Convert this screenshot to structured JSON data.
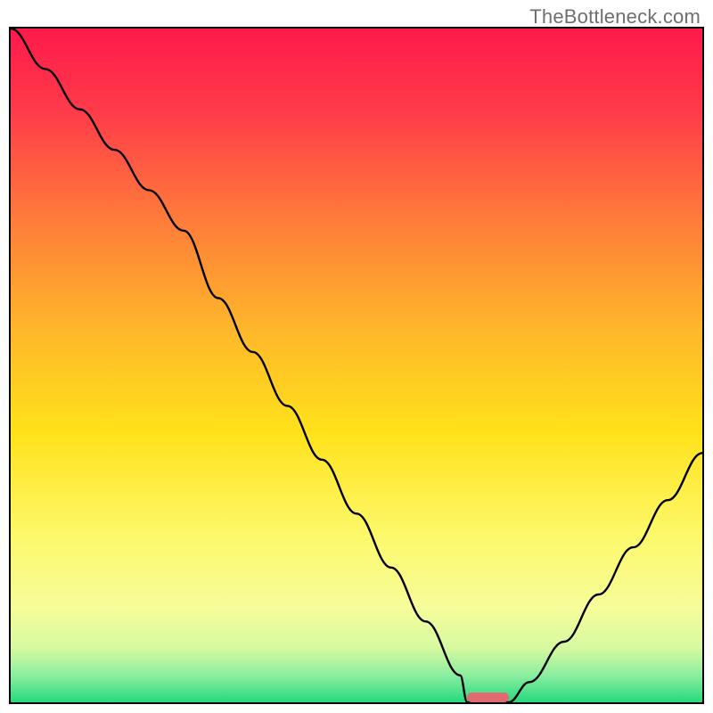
{
  "watermark": "TheBottleneck.com",
  "chart_data": {
    "type": "line",
    "title": "",
    "xlabel": "",
    "ylabel": "",
    "xlim": [
      0,
      100
    ],
    "ylim": [
      0,
      100
    ],
    "grid": false,
    "legend": false,
    "background_gradient_stops": [
      {
        "pct": 0,
        "color": "#ff1a4b"
      },
      {
        "pct": 12,
        "color": "#ff3a4a"
      },
      {
        "pct": 28,
        "color": "#ff7a3a"
      },
      {
        "pct": 45,
        "color": "#ffb82a"
      },
      {
        "pct": 60,
        "color": "#ffe21a"
      },
      {
        "pct": 75,
        "color": "#fdf86a"
      },
      {
        "pct": 86,
        "color": "#f6fd9a"
      },
      {
        "pct": 92,
        "color": "#d6f9a0"
      },
      {
        "pct": 96,
        "color": "#8aeea0"
      },
      {
        "pct": 100,
        "color": "#27d97d"
      }
    ],
    "series": [
      {
        "name": "bottleneck-curve",
        "color": "#000000",
        "x": [
          0,
          5,
          10,
          15,
          20,
          25,
          30,
          35,
          40,
          45,
          50,
          55,
          60,
          65,
          66,
          70,
          72,
          75,
          80,
          85,
          90,
          95,
          100
        ],
        "y": [
          100,
          94,
          88,
          82,
          76,
          70,
          60,
          52,
          44,
          36,
          28,
          20,
          12,
          4,
          0,
          0,
          0,
          3,
          9,
          16,
          23,
          30,
          37
        ]
      }
    ],
    "marker": {
      "color": "#e06a6f",
      "x_start": 66,
      "x_end": 72,
      "y": 0,
      "height_pct": 1.5
    }
  }
}
